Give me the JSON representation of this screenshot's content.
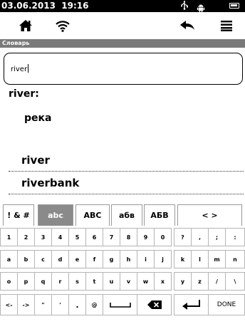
{
  "status": {
    "time": "03.06.2013  19:16",
    "usb_icon": "usb-icon",
    "android_icon": "android-icon",
    "battery_icon": "battery-icon"
  },
  "toolbar": {
    "home_icon": "home-icon",
    "wifi_icon": "wifi-icon",
    "back_icon": "back-arrow-icon",
    "menu_icon": "menu-icon"
  },
  "section": {
    "title": "Словарь"
  },
  "search": {
    "value": "river"
  },
  "result": {
    "headword": "river:",
    "translation": "река"
  },
  "suggestions": [
    "river",
    "riverbank"
  ],
  "keyboard": {
    "tabs": [
      "! & #",
      "abc",
      "ABC",
      "абв",
      "АБВ",
      "< >"
    ],
    "active_tab": "abc",
    "rows": [
      [
        "1",
        "2",
        "3",
        "4",
        "5",
        "6",
        "7",
        "8",
        "9",
        "0",
        "?",
        ",",
        ";",
        ":"
      ],
      [
        "a",
        "b",
        "c",
        "d",
        "e",
        "f",
        "g",
        "h",
        "i",
        "j",
        "k",
        "l",
        "m",
        "n"
      ],
      [
        "o",
        "p",
        "q",
        "r",
        "s",
        "t",
        "u",
        "v",
        "w",
        "x",
        "y",
        "z",
        "/",
        "\\"
      ],
      [
        "<-",
        "->",
        "\"",
        "'",
        ".",
        "@",
        "",
        "",
        "",
        ""
      ]
    ],
    "done_label": "DONE"
  }
}
